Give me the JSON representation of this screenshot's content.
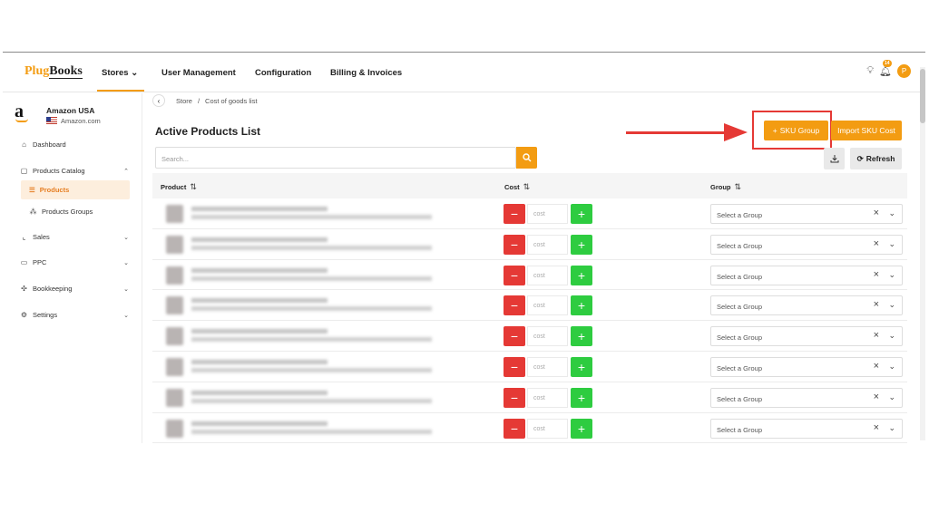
{
  "nav": {
    "logo_plug": "Plug",
    "logo_books": "Books",
    "items": [
      "Stores",
      "User Management",
      "Configuration",
      "Billing & Invoices"
    ],
    "notification_count": "14",
    "avatar_initial": "P"
  },
  "store": {
    "name": "Amazon USA",
    "domain": "Amazon.com"
  },
  "sidebar": {
    "dashboard": "Dashboard",
    "catalog": "Products Catalog",
    "products": "Products",
    "product_groups": "Products Groups",
    "sales": "Sales",
    "ppc": "PPC",
    "bookkeeping": "Bookkeeping",
    "settings": "Settings"
  },
  "breadcrumb": {
    "store": "Store",
    "separator": "/",
    "current": "Cost of goods list"
  },
  "page": {
    "title": "Active Products List",
    "search_placeholder": "Search...",
    "sku_group_label": "SKU Group",
    "import_label": "Import SKU Cost",
    "refresh_label": "Refresh"
  },
  "table": {
    "headers": {
      "product": "Product",
      "cost": "Cost",
      "group": "Group"
    },
    "cost_placeholder": "cost",
    "group_placeholder": "Select a Group",
    "row_count": 8
  },
  "colors": {
    "accent": "#f39c12",
    "danger": "#e53935",
    "success": "#2ecc40"
  }
}
